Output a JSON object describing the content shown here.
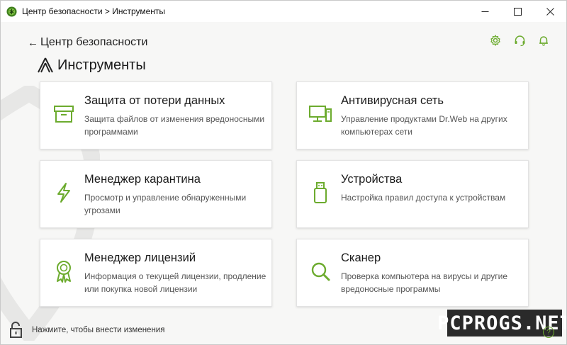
{
  "window": {
    "title": "Центр безопасности > Инструменты",
    "minimize_icon": "minimize-icon",
    "maximize_icon": "maximize-icon",
    "close_icon": "close-icon"
  },
  "header": {
    "back_label": "Центр безопасности",
    "page_title": "Инструменты",
    "icons": [
      "gear-icon",
      "headset-icon",
      "bell-icon"
    ]
  },
  "cards": [
    {
      "title": "Защита от потери данных",
      "desc": "Защита файлов от изменения вредоносными программами",
      "icon": "archive-box-icon"
    },
    {
      "title": "Антивирусная сеть",
      "desc": "Управление продуктами Dr.Web на других компьютерах сети",
      "icon": "network-computers-icon"
    },
    {
      "title": "Менеджер карантина",
      "desc": "Просмотр и управление обнаруженными угрозами",
      "icon": "lightning-icon"
    },
    {
      "title": "Устройства",
      "desc": "Настройка правил доступа к устройствам",
      "icon": "usb-drive-icon"
    },
    {
      "title": "Менеджер лицензий",
      "desc": "Информация о текущей лицензии, продление или покупка новой лицензии",
      "icon": "award-ribbon-icon"
    },
    {
      "title": "Сканер",
      "desc": "Проверка компьютера на вирусы и другие вредоносные программы",
      "icon": "magnifier-icon"
    }
  ],
  "footer": {
    "lock_text": "Нажмите, чтобы внести изменения"
  },
  "watermark_text": "PCPROGS.NET",
  "colors": {
    "accent": "#6cab2e",
    "background": "#f7f7f6",
    "card": "#ffffff"
  }
}
